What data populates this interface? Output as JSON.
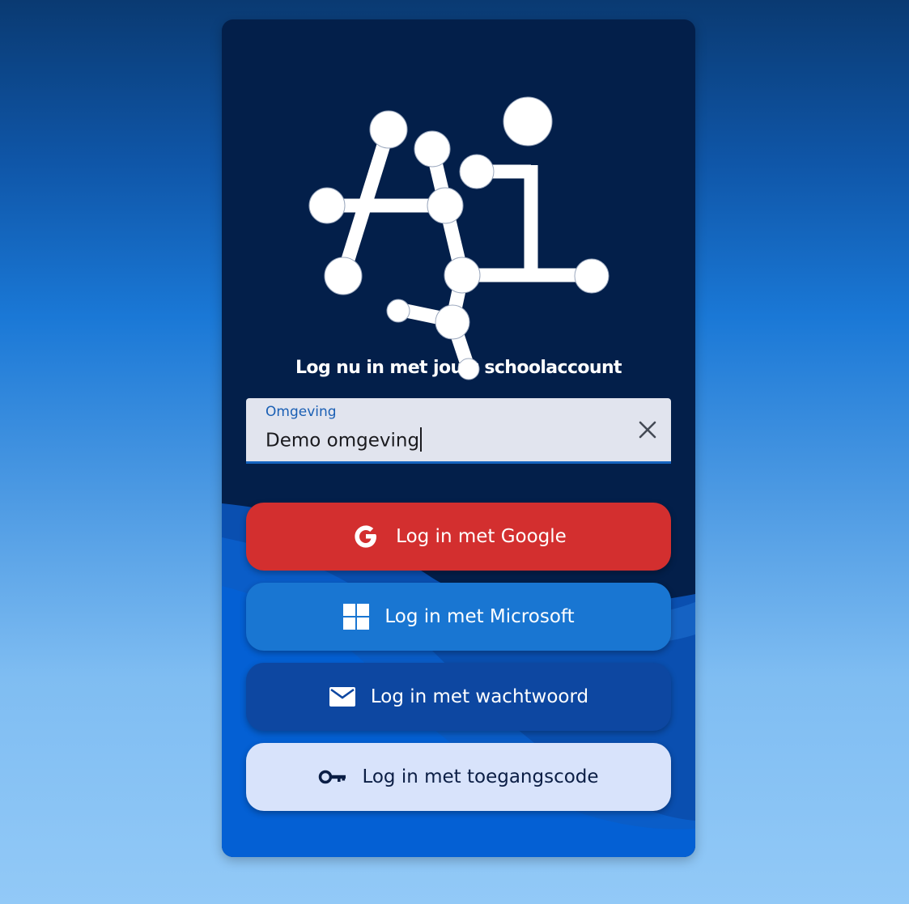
{
  "login_card": {
    "title": "Log nu in met jouw schoolaccount",
    "environment_field": {
      "label": "Omgeving",
      "value": "Demo omgeving"
    },
    "buttons": {
      "google": "Log in met Google",
      "microsoft": "Log in met Microsoft",
      "password": "Log in met wachtwoord",
      "access_code": "Log in met toegangscode"
    }
  },
  "icons": {
    "logo": "ai-network-logo",
    "clear": "close-icon",
    "google": "google-icon",
    "microsoft": "windows-icon",
    "password": "mail-icon",
    "access_code": "key-icon"
  },
  "colors": {
    "card_background": "#031f4a",
    "google_button": "#d32f2f",
    "microsoft_button": "#1976d2",
    "password_button": "#0d47a1",
    "access_code_button": "#d8e3fb",
    "field_accent": "#1564c0"
  }
}
